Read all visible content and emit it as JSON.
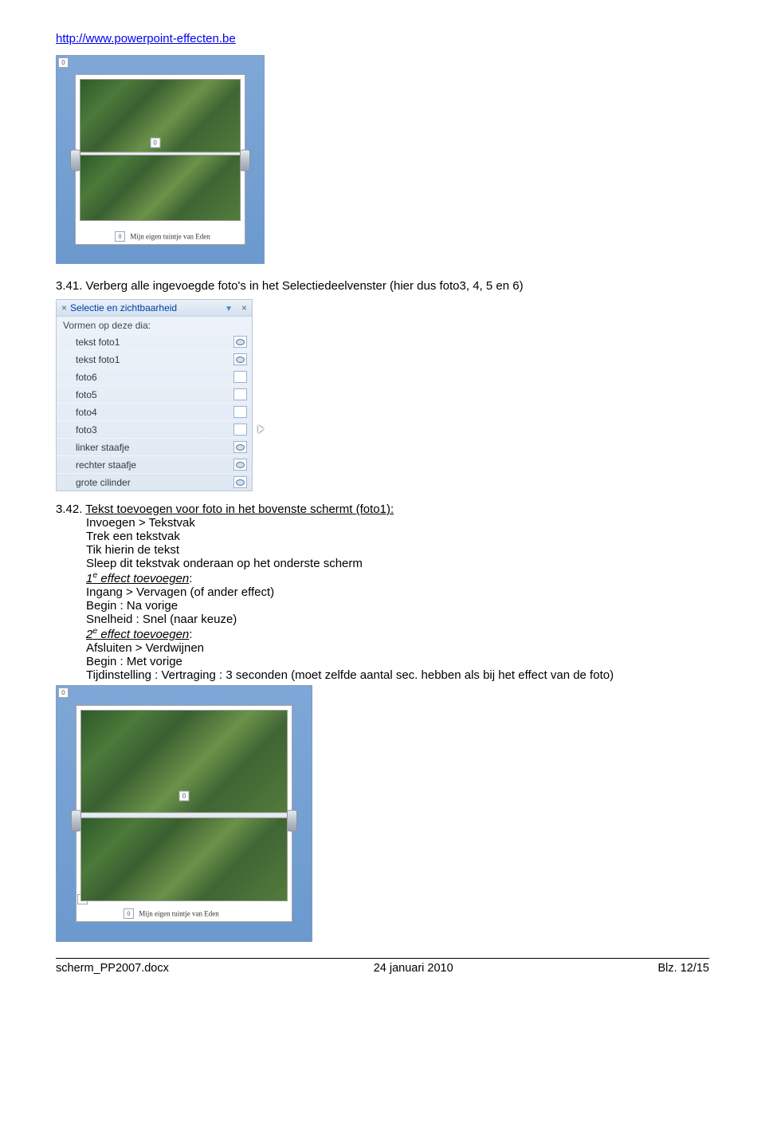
{
  "header": {
    "url": "http://www.powerpoint-effecten.be"
  },
  "illus1": {
    "zero": "0",
    "caption": "Mijn eigen tuintje van Eden"
  },
  "para341": "3.41. Verberg alle ingevoegde foto's in het Selectiedeelvenster (hier dus foto3, 4, 5 en 6)",
  "panel": {
    "close_x": "×",
    "title": "Selectie en zichtbaarheid",
    "dropdown": "▼",
    "close2": "×",
    "sub": "Vormen op deze dia:",
    "items": [
      {
        "label": "tekst foto1",
        "on": true
      },
      {
        "label": "tekst foto1",
        "on": true
      },
      {
        "label": "foto6",
        "on": false
      },
      {
        "label": "foto5",
        "on": false
      },
      {
        "label": "foto4",
        "on": false
      },
      {
        "label": "foto3",
        "on": false,
        "cursor": true
      },
      {
        "label": "linker staafje",
        "on": true
      },
      {
        "label": "rechter staafje",
        "on": true
      },
      {
        "label": "grote cilinder",
        "on": true
      }
    ]
  },
  "sec342": {
    "title_pre": "3.42. ",
    "title_u": "Tekst toevoegen voor foto in het bovenste schermt (foto1):",
    "lines": [
      "Invoegen > Tekstvak",
      "Trek een tekstvak",
      "Tik hierin de tekst",
      "Sleep dit tekstvak onderaan op het onderste scherm"
    ],
    "eff1_label_pre": "1",
    "eff1_label_sup": "e",
    "eff1_label_post": " effect toevoegen",
    "eff1_lines": [
      "Ingang > Vervagen (of ander effect)",
      "Begin : Na vorige",
      "Snelheid : Snel (naar keuze)"
    ],
    "eff2_label_pre": "2",
    "eff2_label_sup": "e",
    "eff2_label_post": " effect toevoegen",
    "eff2_lines": [
      "Afsluiten > Verdwijnen",
      "Begin : Met vorige",
      "Tijdinstelling : Vertraging : 3 seconden (moet zelfde aantal sec. hebben als bij het effect van de foto)"
    ]
  },
  "illus2": {
    "zero": "0",
    "caption": "Mijn eigen tuintje van Eden"
  },
  "footer": {
    "left": "scherm_PP2007.docx",
    "center": "24 januari 2010",
    "right": "Blz. 12/15"
  }
}
